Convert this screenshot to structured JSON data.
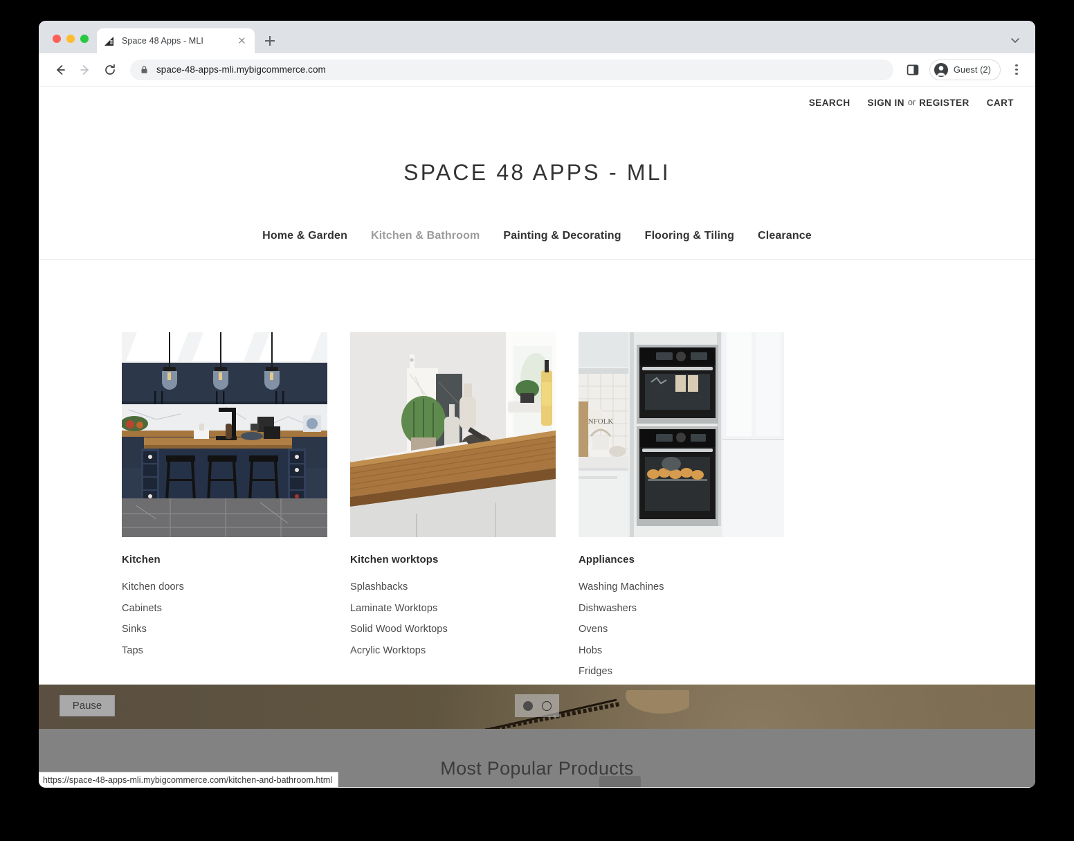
{
  "browser": {
    "tab": {
      "title": "Space 48 Apps - MLI",
      "favicon_name": "space48-logo-icon",
      "close_label": "x"
    },
    "new_tab_label": "+",
    "toolbar": {
      "back_label": "Back",
      "forward_label": "Forward",
      "reload_label": "Reload",
      "lock_label": "Secure",
      "url": "space-48-apps-mli.mybigcommerce.com",
      "side_panel_label": "Side panel",
      "profile_label": "Guest (2)",
      "menu_label": "Customize and control Google Chrome"
    },
    "status_bar": {
      "url": "https://space-48-apps-mli.mybigcommerce.com/kitchen-and-bathroom.html"
    }
  },
  "site": {
    "utility_nav": {
      "search": "SEARCH",
      "sign_in": "SIGN IN",
      "separator": "or",
      "register": "REGISTER",
      "cart": "CART"
    },
    "store_title": "SPACE 48 APPS - MLI",
    "main_nav": [
      {
        "label": "Home & Garden",
        "state": "default"
      },
      {
        "label": "Kitchen & Bathroom",
        "state": "active"
      },
      {
        "label": "Painting & Decorating",
        "state": "default"
      },
      {
        "label": "Flooring & Tiling",
        "state": "default"
      },
      {
        "label": "Clearance",
        "state": "default"
      }
    ],
    "mega_menu": {
      "columns": [
        {
          "heading": "Kitchen",
          "image_name": "kitchen-interior-photo",
          "links": [
            "Kitchen doors",
            "Cabinets",
            "Sinks",
            "Taps"
          ]
        },
        {
          "heading": "Kitchen worktops",
          "image_name": "wooden-worktop-photo",
          "links": [
            "Splashbacks",
            "Laminate Worktops",
            "Solid Wood Worktops",
            "Acrylic Worktops"
          ]
        },
        {
          "heading": "Appliances",
          "image_name": "built-in-ovens-photo",
          "links": [
            "Washing Machines",
            "Dishwashers",
            "Ovens",
            "Hobs",
            "Fridges"
          ]
        }
      ]
    },
    "carousel": {
      "pause_label": "Pause",
      "slides": 2,
      "active_slide": 1
    },
    "popular_section": {
      "title": "Most Popular Products"
    }
  },
  "colors": {
    "tab_strip": "#dee1e6",
    "omnibox": "#f1f3f4",
    "text_dark": "#333333",
    "nav_muted": "#9b9b9b",
    "carousel_overlay": "#5c5142",
    "popular_overlay": "#828282"
  }
}
